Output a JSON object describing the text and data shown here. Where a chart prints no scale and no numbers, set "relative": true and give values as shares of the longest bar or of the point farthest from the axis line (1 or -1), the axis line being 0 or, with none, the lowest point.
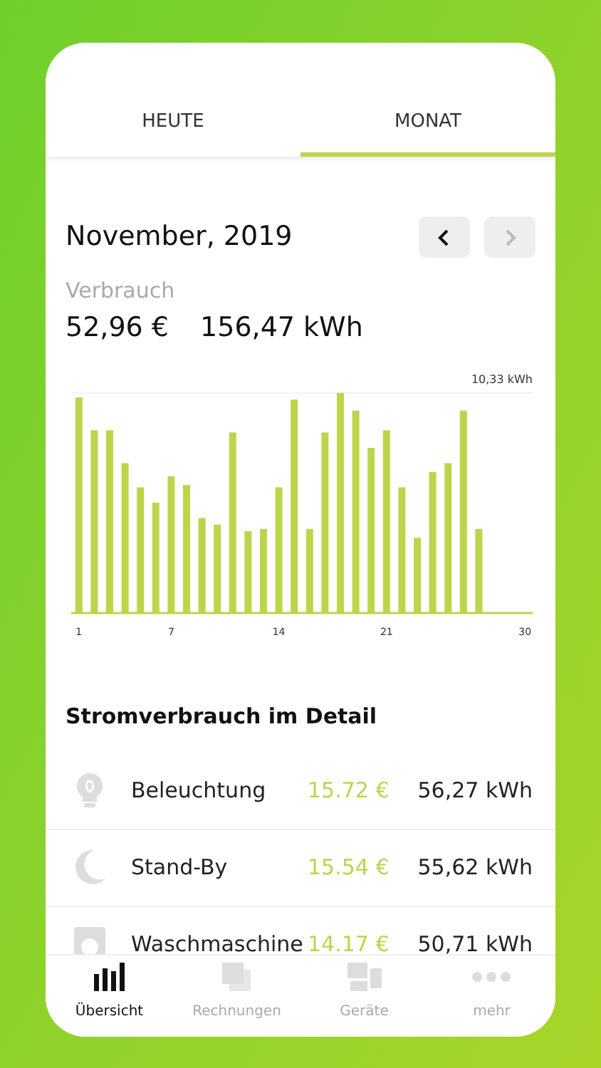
{
  "tabs": [
    {
      "label": "HEUTE",
      "selected": false
    },
    {
      "label": "MONAT",
      "selected": true
    }
  ],
  "period": {
    "title": "November, 2019",
    "prev_disabled": false,
    "next_disabled": true
  },
  "summary": {
    "label": "Verbrauch",
    "cost": "52,96 €",
    "energy": "156,47 kWh"
  },
  "chart_data": {
    "type": "bar",
    "x": [
      1,
      2,
      3,
      4,
      5,
      6,
      7,
      8,
      9,
      10,
      11,
      12,
      13,
      14,
      15,
      16,
      17,
      18,
      19,
      20,
      21,
      22,
      23,
      24,
      25,
      26,
      27
    ],
    "series": [
      {
        "color": "#bcd54a",
        "values": [
          0.98,
          0.83,
          0.83,
          0.68,
          0.57,
          0.5,
          0.62,
          0.58,
          0.43,
          0.4,
          0.82,
          0.37,
          0.38,
          0.57,
          0.97,
          0.38,
          0.82,
          1,
          0.92,
          0.75,
          0.83,
          0.57,
          0.34,
          0.64,
          0.68,
          0.92,
          0.38
        ]
      }
    ],
    "relative": true,
    "annotations": [
      "10,33 kWh"
    ],
    "xlim": [
      0.5,
      30.5
    ],
    "xticks": [
      1,
      7,
      14,
      21,
      30
    ]
  },
  "detail": {
    "title": "Stromverbrauch im Detail",
    "items": [
      {
        "kind": "bulb",
        "name": "Beleuchtung",
        "cost": "15.72 €",
        "energy": "56,27 kWh"
      },
      {
        "kind": "moon",
        "name": "Stand-By",
        "cost": "15.54 €",
        "energy": "55,62 kWh"
      },
      {
        "kind": "washer",
        "name": "Waschmaschine",
        "cost": "14.17 €",
        "energy": "50,71 kWh"
      }
    ]
  },
  "nav": [
    {
      "kind": "chart",
      "label": "Übersicht",
      "selected": true
    },
    {
      "kind": "bills",
      "label": "Rechnungen",
      "selected": false
    },
    {
      "kind": "devices",
      "label": "Geräte",
      "selected": false
    },
    {
      "kind": "more",
      "label": "mehr",
      "selected": false
    }
  ]
}
